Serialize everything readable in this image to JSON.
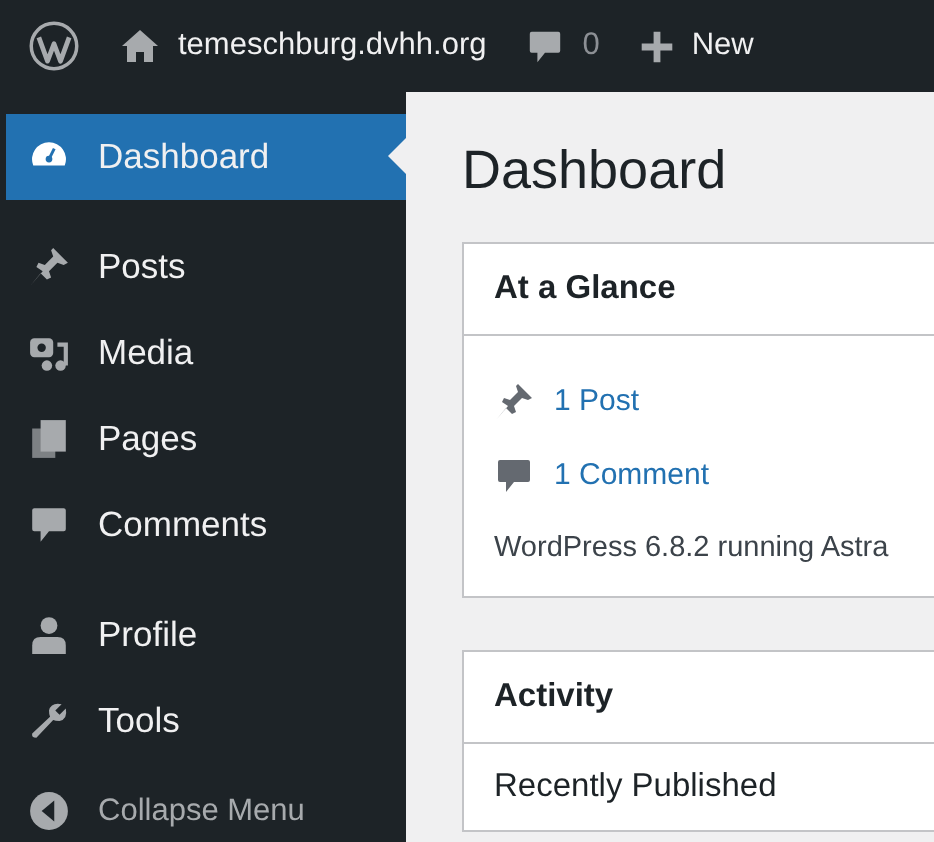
{
  "top_bar": {
    "site": "temeschburg.dvhh.org",
    "comments_count": "0",
    "new_label": "New"
  },
  "sidebar": {
    "groups": [
      [
        {
          "label": "Dashboard",
          "selected": true
        }
      ],
      [
        {
          "label": "Posts",
          "selected": false
        },
        {
          "label": "Media",
          "selected": false
        },
        {
          "label": "Pages",
          "selected": false
        },
        {
          "label": "Comments",
          "selected": false
        }
      ],
      [
        {
          "label": "Profile",
          "selected": false
        },
        {
          "label": "Tools",
          "selected": false
        }
      ]
    ],
    "collapse": "Collapse Menu"
  },
  "page_title": "Dashboard",
  "at_a_glance": {
    "title": "At a Glance",
    "links": [
      "1 Post",
      "1 Comment"
    ],
    "info": "WordPress 6.8.2 running Astra"
  },
  "activity": {
    "title": "Activity",
    "subtitle": "Recently Published"
  }
}
